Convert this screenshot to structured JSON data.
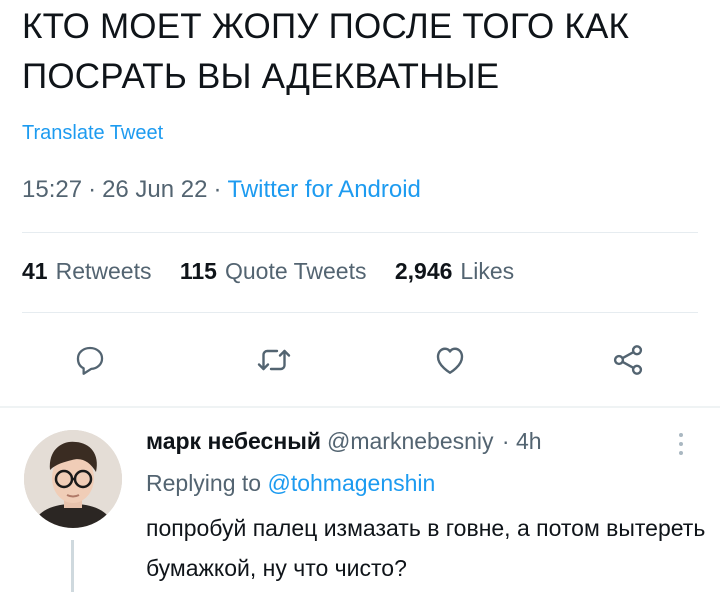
{
  "tweet": {
    "text": "КТО МОЕТ ЖОПУ ПОСЛЕ ТОГО КАК ПОСРАТЬ ВЫ АДЕКВАТНЫЕ",
    "translate_label": "Translate Tweet",
    "time": "15:27",
    "date": "26 Jun 22",
    "source": "Twitter for Android",
    "separator": "·"
  },
  "stats": {
    "retweets": {
      "count": "41",
      "label": "Retweets"
    },
    "quotes": {
      "count": "115",
      "label": "Quote Tweets"
    },
    "likes": {
      "count": "2,946",
      "label": "Likes"
    }
  },
  "actions": [
    "reply-icon",
    "retweet-icon",
    "like-icon",
    "share-icon"
  ],
  "reply": {
    "display_name": "марк небесный",
    "handle": "@marknebesniy",
    "age": "· 4h",
    "replying_prefix": "Replying to",
    "replying_to": "@tohmagenshin",
    "text": "попробуй палец измазать в говне, а потом вытереть бумажкой, ну что чисто?"
  },
  "colors": {
    "accent": "#1d9bf0",
    "text": "#0f1419",
    "muted": "#536471",
    "divider": "#e6ecf0"
  }
}
